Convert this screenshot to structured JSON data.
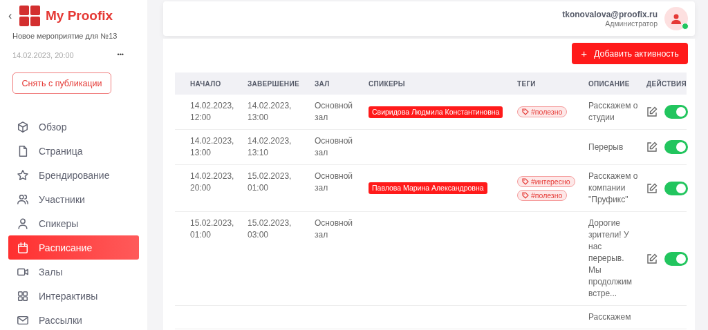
{
  "sidebar": {
    "logo_text": "My Proofix",
    "back": "‹",
    "event_title": "Новое мероприятие для №13",
    "event_date": "14.02.2023, 20:00",
    "more": "•••",
    "unpublish_button": "Снять с публикации",
    "items": [
      {
        "label": "Обзор",
        "selected": false
      },
      {
        "label": "Страница",
        "selected": false
      },
      {
        "label": "Брендирование",
        "selected": false
      },
      {
        "label": "Участники",
        "selected": false
      },
      {
        "label": "Спикеры",
        "selected": false
      },
      {
        "label": "Расписание",
        "selected": true
      },
      {
        "label": "Залы",
        "selected": false
      },
      {
        "label": "Интерактивы",
        "selected": false
      },
      {
        "label": "Рассылки",
        "selected": false
      }
    ]
  },
  "header": {
    "email": "tkonovalova@proofix.ru",
    "role": "Администратор",
    "online": true
  },
  "add_button": {
    "icon": "+",
    "label": "Добавить активность"
  },
  "table": {
    "columns": [
      "НАЧАЛО",
      "ЗАВЕРШЕНИЕ",
      "ЗАЛ",
      "СПИКЕРЫ",
      "ТЕГИ",
      "ОПИСАНИЕ",
      "ДЕЙСТВИЯ"
    ],
    "rows": [
      {
        "start": "14.02.2023, 12:00",
        "end": "14.02.2023, 13:00",
        "hall": "Основной зал",
        "speakers": [
          "Свиридова Людмила Константиновна"
        ],
        "tags": [
          "#полезно"
        ],
        "description": "Расскажем о студии",
        "on": true
      },
      {
        "start": "14.02.2023, 13:00",
        "end": "14.02.2023, 13:10",
        "hall": "Основной зал",
        "speakers": [],
        "tags": [],
        "description": "Перерыв",
        "on": true
      },
      {
        "start": "14.02.2023, 20:00",
        "end": "15.02.2023, 01:00",
        "hall": "Основной зал",
        "speakers": [
          "Павлова Марина Александровна"
        ],
        "tags": [
          "#интересно",
          "#полезно"
        ],
        "description": "Расскажем о компании \"Пруфикс\"",
        "on": true
      },
      {
        "start": "15.02.2023, 01:00",
        "end": "15.02.2023, 03:00",
        "hall": "Основной зал",
        "speakers": [],
        "tags": [],
        "description": "Дорогие зрители! У нас перерыв. Мы продолжим встре...",
        "on": true
      },
      {
        "description": "Расскажем"
      }
    ]
  }
}
